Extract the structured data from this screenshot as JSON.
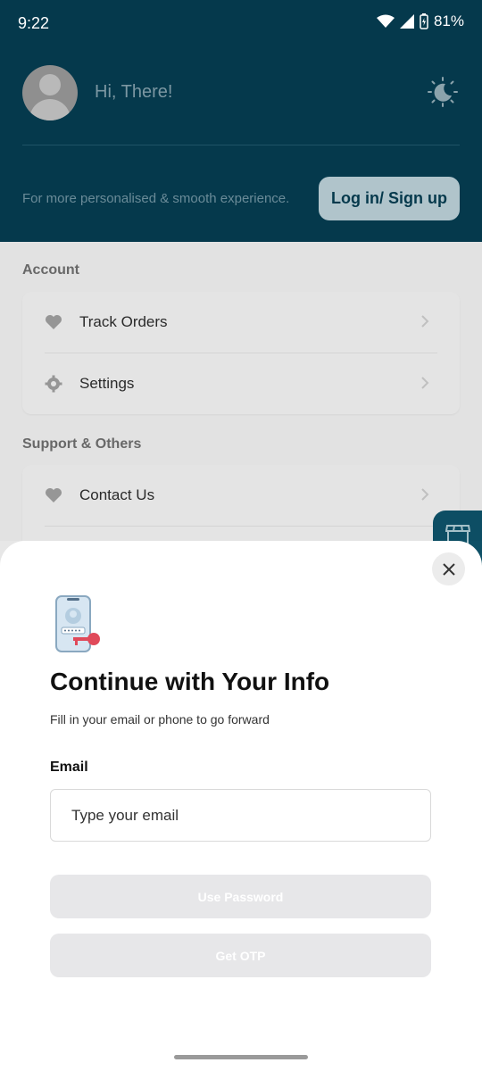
{
  "status_bar": {
    "time": "9:22",
    "battery": "81%"
  },
  "header": {
    "greeting": "Hi, There!",
    "tagline": "For more personalised & smooth experience.",
    "login_label": "Log in/ Sign up"
  },
  "account": {
    "title": "Account",
    "items": [
      {
        "label": "Track Orders",
        "icon": "heart-icon"
      },
      {
        "label": "Settings",
        "icon": "gear-icon"
      }
    ]
  },
  "support": {
    "title": "Support & Others",
    "items": [
      {
        "label": "Contact Us",
        "icon": "heart-icon"
      }
    ]
  },
  "sheet": {
    "title": "Continue with Your Info",
    "subtitle": "Fill in your email or phone to go forward",
    "email_label": "Email",
    "email_placeholder": "Type your email",
    "email_value": "",
    "use_password_label": "Use Password",
    "get_otp_label": "Get OTP"
  },
  "colors": {
    "header_bg": "#05394c",
    "login_button_bg": "#b0c4cb",
    "disabled_button_bg": "#e7e7e9",
    "accent_red": "#e04a5a"
  }
}
